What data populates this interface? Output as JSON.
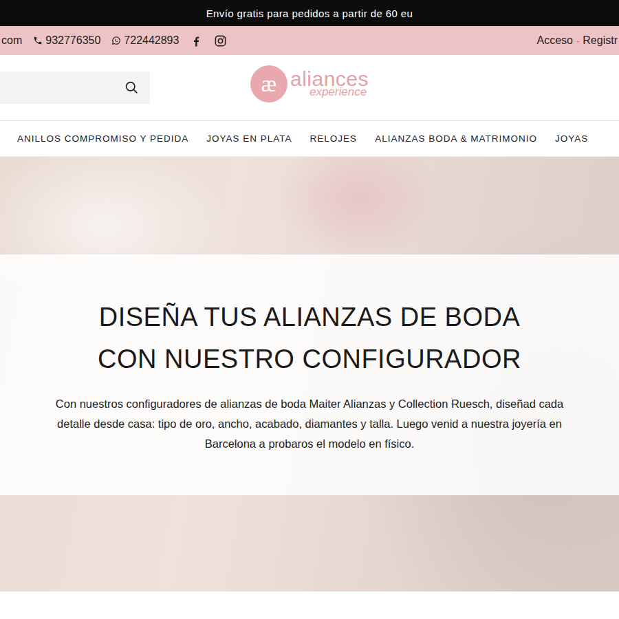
{
  "announcement": "Envío gratis para pedidos a partir de 60 eu",
  "contact_bar": {
    "email": "com",
    "phone": "932776350",
    "whatsapp": "722442893",
    "account_links": [
      "Acceso",
      "Registr"
    ],
    "separator": "-"
  },
  "logo": {
    "monogram": "æ",
    "name": "aliances",
    "tagline": "experience"
  },
  "nav": {
    "items": [
      "ANILLOS COMPROMISO Y PEDIDA",
      "JOYAS EN PLATA",
      "RELOJES",
      "ALIANZAS BODA & MATRIMONIO",
      "JOYAS"
    ]
  },
  "hero": {
    "title_lines": [
      "DISEÑA TUS ALIANZAS DE BODA",
      "CON NUESTRO CONFIGURADOR"
    ],
    "text": "Con nuestros configuradores de alianzas de boda Maiter Alianzas y Collection Ruesch, diseñad cada detalle desde casa: tipo de oro, ancho, acabado, diamantes y talla. Luego venid a nuestra joyería en Barcelona a probaros el modelo en físico."
  }
}
